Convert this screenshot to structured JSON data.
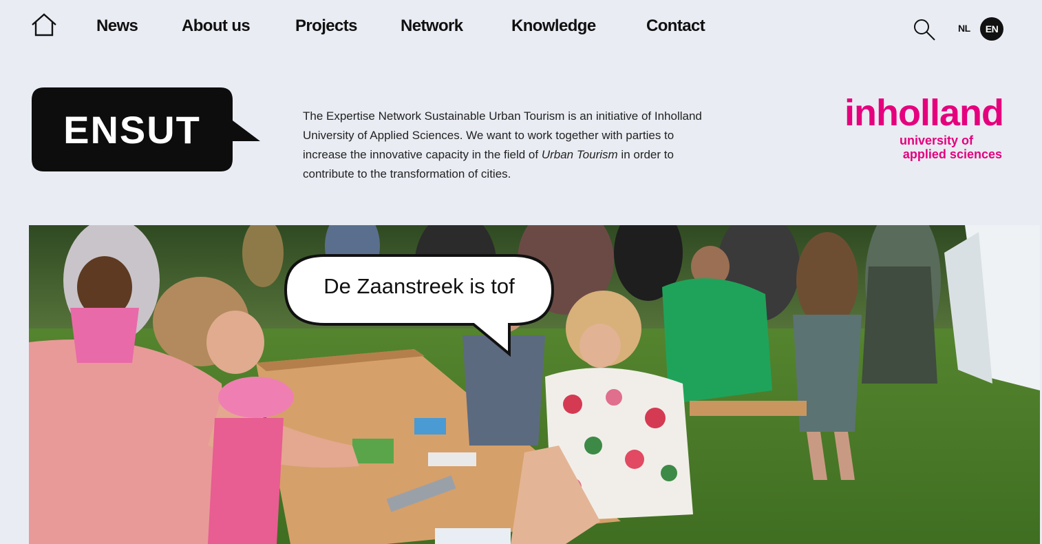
{
  "nav": {
    "links": [
      "News",
      "About us",
      "Projects",
      "Network",
      "Knowledge",
      "Contact"
    ],
    "lang_nl": "NL",
    "lang_en": "EN"
  },
  "header": {
    "logo_text": "ENSUT",
    "intro_part1": "The Expertise Network Sustainable Urban Tourism is an initiative of Inholland University of Applied Sciences. We want to work together with parties to increase the innovative capacity in the field of ",
    "intro_em": "Urban Tourism",
    "intro_part2": " in order to contribute to the transformation of cities.",
    "partner": {
      "name": "inholland",
      "sub1": "university of",
      "sub2": "applied sciences"
    }
  },
  "hero": {
    "caption": "De Zaanstreek is tof"
  },
  "colors": {
    "background": "#e9ecf3",
    "brand_pink": "#e5007d",
    "text_dark": "#101010"
  },
  "icons": [
    "home-icon",
    "search-icon"
  ]
}
